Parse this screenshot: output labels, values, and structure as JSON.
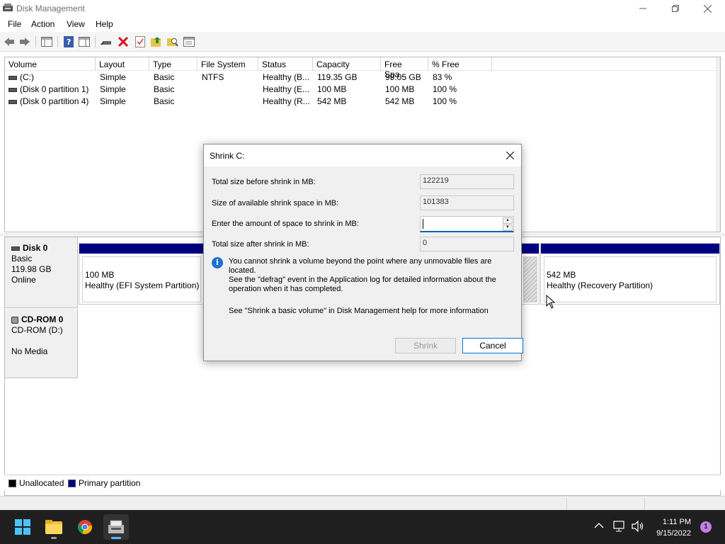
{
  "window": {
    "title": "Disk Management"
  },
  "menu": [
    "File",
    "Action",
    "View",
    "Help"
  ],
  "volume_table": {
    "columns": [
      "Volume",
      "Layout",
      "Type",
      "File System",
      "Status",
      "Capacity",
      "Free Spa...",
      "% Free"
    ],
    "rows": [
      [
        "(C:)",
        "Simple",
        "Basic",
        "NTFS",
        "Healthy (B...",
        "119.35 GB",
        "99.05 GB",
        "83 %"
      ],
      [
        "(Disk 0 partition 1)",
        "Simple",
        "Basic",
        "",
        "Healthy (E...",
        "100 MB",
        "100 MB",
        "100 %"
      ],
      [
        "(Disk 0 partition 4)",
        "Simple",
        "Basic",
        "",
        "Healthy (R...",
        "542 MB",
        "542 MB",
        "100 %"
      ]
    ]
  },
  "disks": {
    "disk0": {
      "name": "Disk 0",
      "type": "Basic",
      "size": "119.98 GB",
      "state": "Online"
    },
    "cdrom0": {
      "name": "CD-ROM 0",
      "type": "CD-ROM (D:)",
      "state": "No Media"
    }
  },
  "partitions": {
    "efi": {
      "size": "100 MB",
      "status": "Healthy (EFI System Partition)"
    },
    "recovery": {
      "size": "542 MB",
      "status": "Healthy (Recovery Partition)"
    }
  },
  "legend": {
    "unallocated": "Unallocated",
    "primary": "Primary partition"
  },
  "dialog": {
    "title": "Shrink C:",
    "total_label": "Total size before shrink in MB:",
    "total_value": "122219",
    "available_label": "Size of available shrink space in MB:",
    "available_value": "101383",
    "amount_label": "Enter the amount of space to shrink in MB:",
    "amount_value": "",
    "after_label": "Total size after shrink in MB:",
    "after_value": "0",
    "info_line1": "You cannot shrink a volume beyond the point where any unmovable files are located.",
    "info_line2": "See the \"defrag\" event in the Application log for detailed information about the",
    "info_line3": "operation when it has completed.",
    "help_text": "See \"Shrink a basic volume\" in Disk Management help for more information",
    "shrink_button": "Shrink",
    "cancel_button": "Cancel"
  },
  "taskbar": {
    "time": "1:11 PM",
    "date": "9/15/2022",
    "notification_count": "1"
  },
  "colors": {
    "primary_partition": "#000080",
    "accent": "#0078d7",
    "taskbar": "#1f1f1f"
  }
}
